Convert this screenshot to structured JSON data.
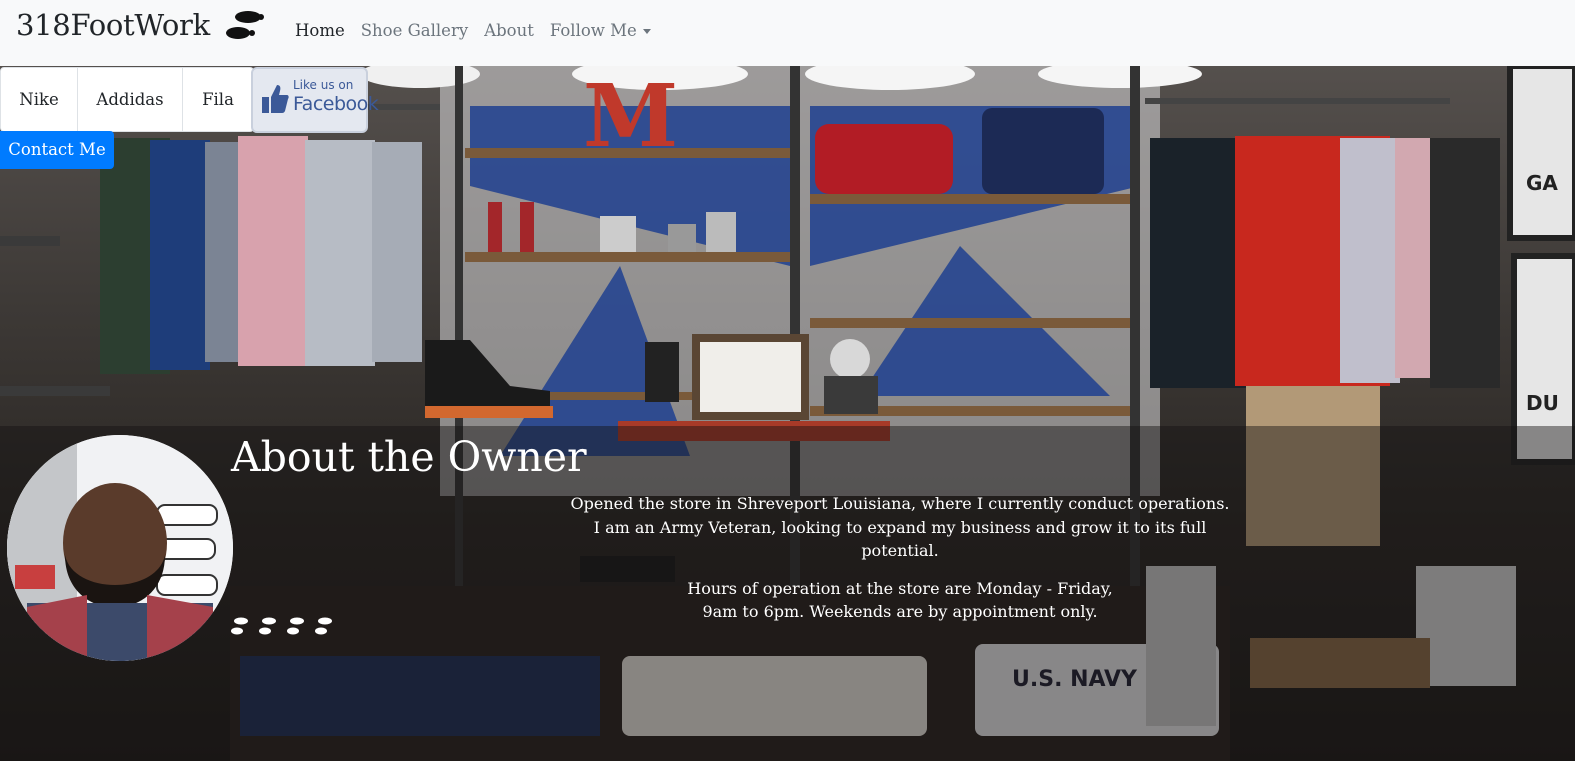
{
  "navbar": {
    "brand": "318FootWork",
    "brand_icon": "footprints-icon",
    "links": [
      {
        "label": "Home",
        "active": true
      },
      {
        "label": "Shoe Gallery",
        "active": false
      },
      {
        "label": "About",
        "active": false
      },
      {
        "label": "Follow Me",
        "active": false,
        "dropdown": true
      }
    ]
  },
  "brand_tabs": [
    "Nike",
    "Addidas",
    "Fila"
  ],
  "facebook_badge": {
    "line1": "Like us on",
    "line2": "Facebook",
    "icon": "thumbs-up-icon"
  },
  "contact_button": "Contact Me",
  "about": {
    "title": "About the Owner",
    "paragraph1_line1": "Opened the store in Shreveport Louisiana, where I currently conduct operations.",
    "paragraph1_line2": "I am an Army Veteran, looking to expand my business and grow it to its full potential.",
    "paragraph2_line1": "Hours of operation at the store are Monday - Friday,",
    "paragraph2_line2": "9am to 6pm. Weekends are by appointment only.",
    "decoration_icon": "footprints-icon"
  },
  "colors": {
    "primary": "#007bff",
    "navbar_bg": "#f8f9fa",
    "facebook": "#3b5998"
  }
}
